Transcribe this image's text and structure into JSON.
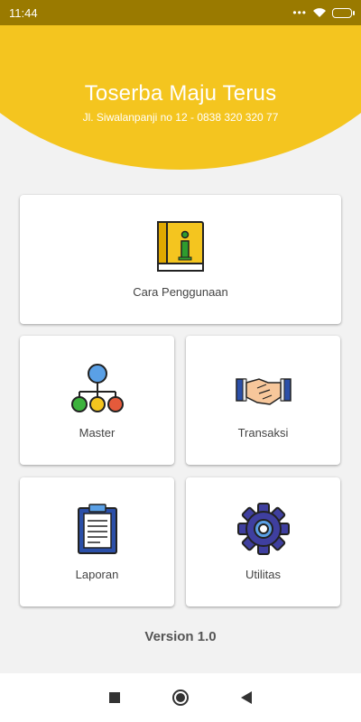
{
  "status_bar": {
    "time": "11:44",
    "dots": "•••"
  },
  "header": {
    "title": "Toserba Maju Terus",
    "subtitle": "Jl. Siwalanpanji no 12 - 0838 320 320 77"
  },
  "menu": {
    "guide_label": "Cara Penggunaan",
    "master_label": "Master",
    "transaction_label": "Transaksi",
    "report_label": "Laporan",
    "utility_label": "Utilitas"
  },
  "footer": {
    "version": "Version 1.0"
  },
  "colors": {
    "accent": "#f4c51f",
    "status_bar": "#9a7a00"
  }
}
